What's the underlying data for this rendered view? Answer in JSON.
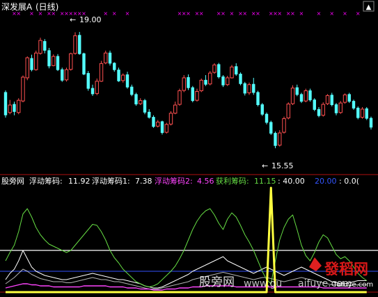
{
  "main_pane": {
    "title_prefix": "深发展",
    "title_mark": "A",
    "title_period": "(日线)",
    "high_label": "19.00",
    "low_label": "15.55"
  },
  "indicator_pane": {
    "title": "股旁网",
    "fudong_label": "浮动筹码:",
    "fudong_value": "11.92",
    "fudong1_label": "浮动筹码1:",
    "fudong1_value": "7.38",
    "fudong2_label": "浮动筹码2:",
    "fudong2_value": "4.56",
    "huoli_label": "获利筹码:",
    "huoli_value": "11.15",
    "v40": ": 40.00",
    "v20": "20.00",
    "v0": ": 0.0("
  },
  "watermark": {
    "left": "股旁网",
    "middle": "www.gu",
    "right": "aifuye.com",
    "brand": "發稻网",
    "brand_url": "fafuye.com"
  },
  "colors": {
    "up": "#ff5050",
    "down": "#54ffff",
    "marker": "#ff00ff",
    "fudong": "#ffffff",
    "fudong1": "#ffffff",
    "fudong2": "#ff44ff",
    "huoli": "#66dd44",
    "level40": "#ffffff",
    "level20": "#3355ff",
    "spike": "#ffff40",
    "separator": "#b01010"
  },
  "chart_data": [
    {
      "type": "candlestick",
      "title": "深发展A (日线)",
      "ylim": [
        15.0,
        19.5
      ],
      "annotations": [
        {
          "text": "19.00",
          "value": 19.0
        },
        {
          "text": "15.55",
          "value": 15.55
        }
      ],
      "candles": [
        [
          17.2,
          16.52,
          17.25,
          16.45
        ],
        [
          16.6,
          16.82,
          16.97,
          16.55
        ],
        [
          16.85,
          16.62,
          16.92,
          16.52
        ],
        [
          16.6,
          16.96,
          17.02,
          16.55
        ],
        [
          16.94,
          17.64,
          17.69,
          16.9
        ],
        [
          17.62,
          18.21,
          18.25,
          17.55
        ],
        [
          18.2,
          17.85,
          18.3,
          17.81
        ],
        [
          17.86,
          18.35,
          18.42,
          17.83
        ],
        [
          18.34,
          18.72,
          18.8,
          18.3
        ],
        [
          18.7,
          18.42,
          18.76,
          18.34
        ],
        [
          18.43,
          17.96,
          18.5,
          17.9
        ],
        [
          17.98,
          18.25,
          18.31,
          17.96
        ],
        [
          18.26,
          17.85,
          18.32,
          17.82
        ],
        [
          17.87,
          17.54,
          17.92,
          17.5
        ],
        [
          17.56,
          17.86,
          17.92,
          17.51
        ],
        [
          17.87,
          18.33,
          18.36,
          17.83
        ],
        [
          18.34,
          18.86,
          18.96,
          18.3
        ],
        [
          18.88,
          18.32,
          18.97,
          18.3
        ],
        [
          18.34,
          17.72,
          18.36,
          17.7
        ],
        [
          17.76,
          17.3,
          17.82,
          17.24
        ],
        [
          17.32,
          17.14,
          17.42,
          17.09
        ],
        [
          17.16,
          17.52,
          17.6,
          17.11
        ],
        [
          17.52,
          18.04,
          18.12,
          17.5
        ],
        [
          18.06,
          18.35,
          18.42,
          18.02
        ],
        [
          18.36,
          18.04,
          18.42,
          17.98
        ],
        [
          18.06,
          17.85,
          18.08,
          17.8
        ],
        [
          17.86,
          17.52,
          17.92,
          17.5
        ],
        [
          17.54,
          17.7,
          17.75,
          17.48
        ],
        [
          17.72,
          17.34,
          17.8,
          17.3
        ],
        [
          17.36,
          17.12,
          17.42,
          17.08
        ],
        [
          17.14,
          16.84,
          17.18,
          16.8
        ],
        [
          16.86,
          16.95,
          17.02,
          16.82
        ],
        [
          16.96,
          16.6,
          17.0,
          16.55
        ],
        [
          16.62,
          16.45,
          16.7,
          16.42
        ],
        [
          16.47,
          16.18,
          16.52,
          16.15
        ],
        [
          16.2,
          16.32,
          16.38,
          16.16
        ],
        [
          16.34,
          16.0,
          16.36,
          15.95
        ],
        [
          16.02,
          16.25,
          16.3,
          15.98
        ],
        [
          16.26,
          16.58,
          16.64,
          16.22
        ],
        [
          16.58,
          16.82,
          16.92,
          16.55
        ],
        [
          16.84,
          17.24,
          17.3,
          16.8
        ],
        [
          17.25,
          17.62,
          17.7,
          17.2
        ],
        [
          17.64,
          17.32,
          17.72,
          17.26
        ],
        [
          17.34,
          16.94,
          17.38,
          16.9
        ],
        [
          16.96,
          17.22,
          17.3,
          16.92
        ],
        [
          17.24,
          17.55,
          17.6,
          17.2
        ],
        [
          17.56,
          17.42,
          17.7,
          17.38
        ],
        [
          17.44,
          17.76,
          17.82,
          17.4
        ],
        [
          17.78,
          18.0,
          18.05,
          17.74
        ],
        [
          18.02,
          17.64,
          18.06,
          17.6
        ],
        [
          17.66,
          17.4,
          17.7,
          17.35
        ],
        [
          17.42,
          17.62,
          17.68,
          17.38
        ],
        [
          17.62,
          17.94,
          18.0,
          17.6
        ],
        [
          17.96,
          17.72,
          18.05,
          17.68
        ],
        [
          17.74,
          17.44,
          17.78,
          17.4
        ],
        [
          17.46,
          17.16,
          17.5,
          17.1
        ],
        [
          17.18,
          17.42,
          17.48,
          17.12
        ],
        [
          17.44,
          17.18,
          17.62,
          17.12
        ],
        [
          17.2,
          16.82,
          17.24,
          16.78
        ],
        [
          16.84,
          16.54,
          16.88,
          16.5
        ],
        [
          16.56,
          16.3,
          16.6,
          16.25
        ],
        [
          16.32,
          15.98,
          16.36,
          15.94
        ],
        [
          16.0,
          15.62,
          16.04,
          15.55
        ],
        [
          15.64,
          16.0,
          16.08,
          15.6
        ],
        [
          16.02,
          16.42,
          16.48,
          15.98
        ],
        [
          16.44,
          16.85,
          16.9,
          16.4
        ],
        [
          16.86,
          17.32,
          17.4,
          16.82
        ],
        [
          17.34,
          17.12,
          17.42,
          17.08
        ],
        [
          17.14,
          16.92,
          17.18,
          16.88
        ],
        [
          16.94,
          17.24,
          17.3,
          16.9
        ],
        [
          17.25,
          16.96,
          17.3,
          16.92
        ],
        [
          16.98,
          16.68,
          17.02,
          16.64
        ],
        [
          16.7,
          16.5,
          16.76,
          16.46
        ],
        [
          16.52,
          16.84,
          16.9,
          16.48
        ],
        [
          16.86,
          17.1,
          17.14,
          16.82
        ],
        [
          17.12,
          16.82,
          17.18,
          16.78
        ],
        [
          16.84,
          16.58,
          16.88,
          16.52
        ],
        [
          16.6,
          16.88,
          16.94,
          16.56
        ],
        [
          16.9,
          17.12,
          17.16,
          16.86
        ],
        [
          17.14,
          16.92,
          17.18,
          16.88
        ],
        [
          16.94,
          16.72,
          16.98,
          16.68
        ],
        [
          16.74,
          16.44,
          16.78,
          16.4
        ],
        [
          16.46,
          16.7,
          16.76,
          16.42
        ],
        [
          16.72,
          16.42,
          16.76,
          16.38
        ],
        [
          16.44,
          16.16,
          16.48,
          16.1
        ]
      ],
      "signal_markers": [
        2,
        3,
        6,
        8,
        10,
        11,
        13,
        14,
        15,
        16,
        17,
        18,
        23,
        25,
        28,
        40,
        41,
        42,
        44,
        45,
        49,
        50,
        52,
        54,
        55,
        57,
        58,
        61,
        62,
        63,
        65,
        66,
        68,
        72,
        75,
        78,
        81
      ]
    },
    {
      "type": "line",
      "title": "股旁网",
      "ylim": [
        0,
        100
      ],
      "series": [
        {
          "name": "浮动筹码",
          "values": [
            12,
            18,
            22,
            30,
            40,
            32,
            24,
            20,
            18,
            16,
            15,
            14,
            13,
            12,
            12,
            13,
            14,
            15,
            16,
            17,
            18,
            17,
            16,
            15,
            14,
            13,
            12,
            12,
            11,
            10,
            9,
            8,
            6,
            5,
            4,
            4,
            5,
            7,
            9,
            11,
            13,
            15,
            17,
            20,
            22,
            24,
            26,
            28,
            30,
            32,
            34,
            30,
            28,
            26,
            24,
            22,
            20,
            18,
            20,
            22,
            24,
            22,
            20,
            18,
            16,
            18,
            20,
            22,
            24,
            22,
            20,
            18,
            16,
            14,
            12,
            10,
            9,
            8,
            8,
            9,
            10,
            11,
            11,
            11
          ]
        },
        {
          "name": "浮动筹码1",
          "values": [
            8,
            11,
            14,
            18,
            22,
            20,
            17,
            15,
            13,
            12,
            11,
            10,
            10,
            10,
            9,
            9,
            10,
            11,
            12,
            13,
            14,
            13,
            12,
            12,
            11,
            10,
            10,
            9,
            8,
            7,
            6,
            5,
            4,
            3,
            3,
            3,
            4,
            5,
            6,
            7,
            8,
            9,
            10,
            12,
            13,
            14,
            15,
            16,
            17,
            18,
            19,
            18,
            17,
            16,
            15,
            14,
            13,
            12,
            13,
            14,
            14,
            13,
            12,
            11,
            10,
            11,
            12,
            13,
            14,
            13,
            12,
            11,
            10,
            9,
            8,
            7,
            7,
            6,
            6,
            6,
            7,
            7,
            7,
            7
          ]
        },
        {
          "name": "浮动筹码2",
          "values": [
            4,
            5,
            6,
            7,
            8,
            8,
            7,
            7,
            6,
            6,
            6,
            5,
            5,
            5,
            5,
            5,
            5,
            5,
            6,
            6,
            6,
            6,
            6,
            6,
            5,
            5,
            5,
            5,
            4,
            4,
            4,
            3,
            3,
            3,
            2,
            2,
            2,
            3,
            3,
            3,
            4,
            4,
            4,
            5,
            5,
            5,
            6,
            6,
            6,
            6,
            6,
            6,
            6,
            5,
            5,
            5,
            5,
            5,
            5,
            5,
            5,
            5,
            5,
            5,
            5,
            5,
            5,
            5,
            5,
            5,
            5,
            5,
            5,
            4,
            4,
            4,
            4,
            4,
            4,
            4,
            4,
            4,
            4,
            4
          ]
        },
        {
          "name": "获利筹码",
          "values": [
            30,
            38,
            45,
            58,
            75,
            80,
            72,
            62,
            55,
            50,
            46,
            44,
            42,
            40,
            38,
            40,
            45,
            50,
            55,
            60,
            65,
            64,
            58,
            50,
            40,
            33,
            28,
            22,
            18,
            14,
            10,
            8,
            6,
            5,
            6,
            8,
            12,
            16,
            20,
            25,
            32,
            40,
            50,
            60,
            68,
            74,
            78,
            80,
            74,
            66,
            60,
            70,
            76,
            72,
            64,
            55,
            48,
            40,
            30,
            20,
            12,
            8,
            30,
            50,
            62,
            70,
            74,
            60,
            45,
            35,
            30,
            38,
            48,
            55,
            52,
            44,
            36,
            32,
            34,
            30,
            24,
            18,
            14,
            11
          ]
        },
        {
          "name": "尖峰",
          "values": [
            0,
            0,
            0,
            0,
            0,
            0,
            0,
            0,
            0,
            0,
            0,
            0,
            0,
            0,
            0,
            0,
            0,
            0,
            0,
            0,
            0,
            0,
            0,
            0,
            0,
            0,
            0,
            0,
            0,
            0,
            0,
            0,
            0,
            0,
            0,
            0,
            0,
            0,
            0,
            0,
            0,
            0,
            0,
            0,
            0,
            0,
            0,
            0,
            0,
            0,
            0,
            0,
            0,
            0,
            0,
            0,
            0,
            0,
            0,
            0,
            0,
            100,
            0,
            0,
            0,
            0,
            0,
            0,
            0,
            0,
            0,
            0,
            0,
            0,
            0,
            0,
            0,
            0,
            0,
            0,
            0,
            0,
            0,
            0
          ]
        }
      ],
      "levels": [
        40,
        20,
        0
      ]
    }
  ]
}
